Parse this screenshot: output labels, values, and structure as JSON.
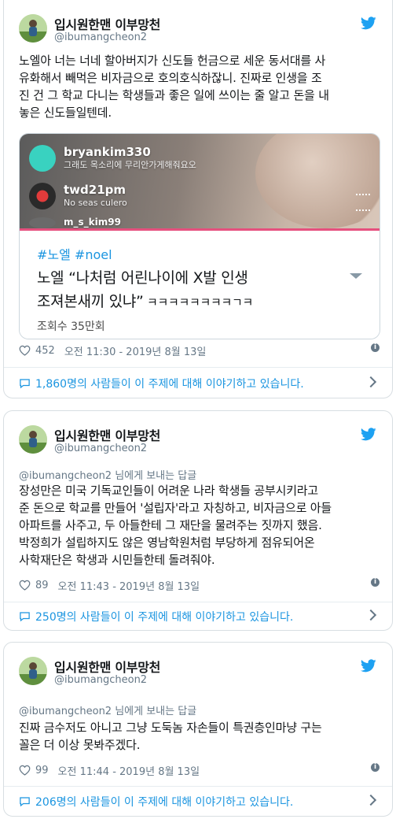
{
  "account": {
    "display_name": "입시원한맨 이부망천",
    "handle": "@ibumangcheon2"
  },
  "tweets": [
    {
      "text": "노엘아 너는 너네 할아버지가 신도들 헌금으로 세운 동서대를 사\n유화해서 빼먹은 비자금으로 호의호식하잖니. 진짜로 인생을 조\n진 건 그 학교 다니는 학생들과 좋은 일에 쓰이는 줄 알고 돈을 내\n놓은 신도들일텐데.",
      "media": {
        "comments": [
          {
            "user": "bryankim330",
            "text": "그래도 목소리에 무리안가게해줘요오"
          },
          {
            "user": "twd21pm",
            "text": "No seas culero"
          },
          {
            "user": "m_s_kim99",
            "text": ""
          }
        ],
        "hashtags": "#노엘 #noel",
        "title_line1": "노엘 “나처럼 어린나이에 X발 인생",
        "title_line2": "조져본새끼 있냐”",
        "title_suffix": " ㅋㅋㅋㅋㅋㅋㅋㅋㄱㅋ",
        "views": "조회수 35만회"
      },
      "likes": "452",
      "timestamp": "오전 11:30 - 2019년 8월 13일",
      "conversation": "1,860명의 사람들이 이 주제에 대해 이야기하고 있습니다."
    },
    {
      "reply_handle": "@ibumangcheon2",
      "reply_suffix": " 님에게 보내는 답글",
      "text": "장성만은 미국 기독교인들이 어려운 나라 학생들 공부시키라고\n준 돈으로 학교를 만들어 '설립자'라고 자칭하고, 비자금으로 아들\n아파트를 사주고, 두 아들한테 그 재단을 물려주는 짓까지 했음.\n박정희가 설립하지도 않은 영남학원처럼 부당하게 점유되어온\n사학재단은 학생과 시민들한테 돌려줘야.",
      "likes": "89",
      "timestamp": "오전 11:43 - 2019년 8월 13일",
      "conversation": "250명의 사람들이 이 주제에 대해 이야기하고 있습니다."
    },
    {
      "reply_handle": "@ibumangcheon2",
      "reply_suffix": " 님에게 보내는 답글",
      "text": "진짜 금수저도 아니고 그냥 도둑놈 자손들이 특권층인마냥 구는\n꼴은 더 이상 못봐주겠다.",
      "likes": "99",
      "timestamp": "오전 11:44 - 2019년 8월 13일",
      "conversation": "206명의 사람들이 이 주제에 대해 이야기하고 있습니다."
    }
  ],
  "icons": {
    "brand": "twitter-bird-icon",
    "like": "heart-icon",
    "info": "info-icon",
    "conversation": "speech-bubble-icon",
    "chevron": "chevron-right-icon"
  },
  "colors": {
    "twitter_blue": "#1da1f2",
    "link_blue": "#1b95e0",
    "secondary_text": "#657786",
    "border": "#d8dee2"
  }
}
